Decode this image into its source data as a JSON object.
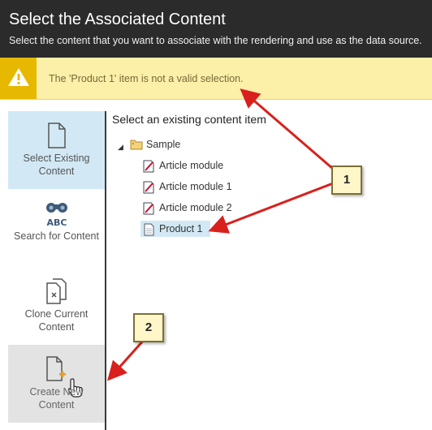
{
  "dialog": {
    "title": "Select the Associated Content",
    "subtitle": "Select the content that you want to associate with the rendering and use as the data source."
  },
  "warning": {
    "message": "The 'Product 1' item is not a valid selection."
  },
  "sidebar": {
    "items": [
      {
        "label": "Select Existing Content",
        "state": "selected"
      },
      {
        "label": "Search for Content",
        "state": "normal"
      },
      {
        "label": "Clone Current Content",
        "state": "normal"
      },
      {
        "label": "Create New Content",
        "state": "hover"
      }
    ]
  },
  "content": {
    "heading": "Select an existing content item",
    "tree": {
      "root": {
        "label": "Sample",
        "icon": "folder-icon"
      },
      "children": [
        {
          "label": "Article module",
          "icon": "document-edit-icon"
        },
        {
          "label": "Article module 1",
          "icon": "document-edit-icon"
        },
        {
          "label": "Article module 2",
          "icon": "document-edit-icon"
        },
        {
          "label": "Product 1",
          "icon": "document-icon",
          "selected": true
        }
      ]
    }
  },
  "annotations": {
    "callout_1": "1",
    "callout_2": "2",
    "arrow_color": "#d9201c"
  },
  "colors": {
    "header_bg": "#2b2b2b",
    "warning_bg": "#fcefa8",
    "warning_icon_bg": "#e6b800",
    "selected_bg": "#d2e9f5"
  }
}
